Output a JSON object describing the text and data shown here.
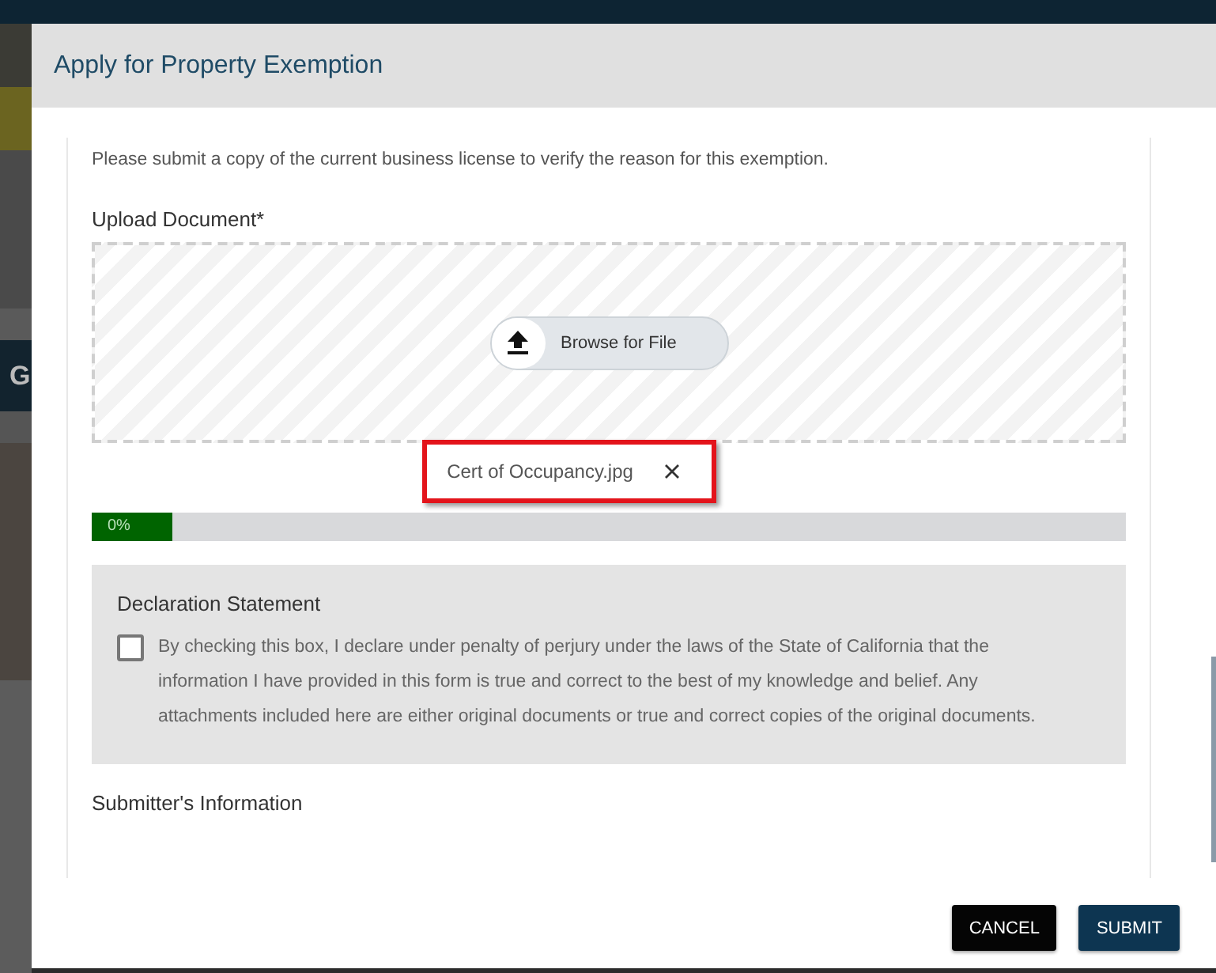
{
  "backdrop": {
    "fragments": [
      "G"
    ]
  },
  "dialog": {
    "title": "Apply for Property Exemption"
  },
  "instructions": "Please submit a copy of the current business license to verify the reason for this exemption.",
  "upload": {
    "label": "Upload Document*",
    "browse_button": "Browse for File",
    "file": {
      "name": "Cert of Occupancy.jpg",
      "highlighted": true
    }
  },
  "progress": {
    "level": 0.078,
    "reading": "0%"
  },
  "declaration": {
    "heading": "Declaration Statement",
    "checked": false,
    "text": "By checking this box, I declare under penalty of perjury under the laws of the State of California that the information I have provided in this form is true and correct to the best of my knowledge and belief. Any attachments included here are either original documents or true and correct copies of the original documents."
  },
  "submitter": {
    "heading": "Submitter's Information"
  },
  "buttons": [
    {
      "label": "CANCEL",
      "kind": "secondary"
    },
    {
      "label": "SUBMIT",
      "kind": "primary"
    }
  ]
}
